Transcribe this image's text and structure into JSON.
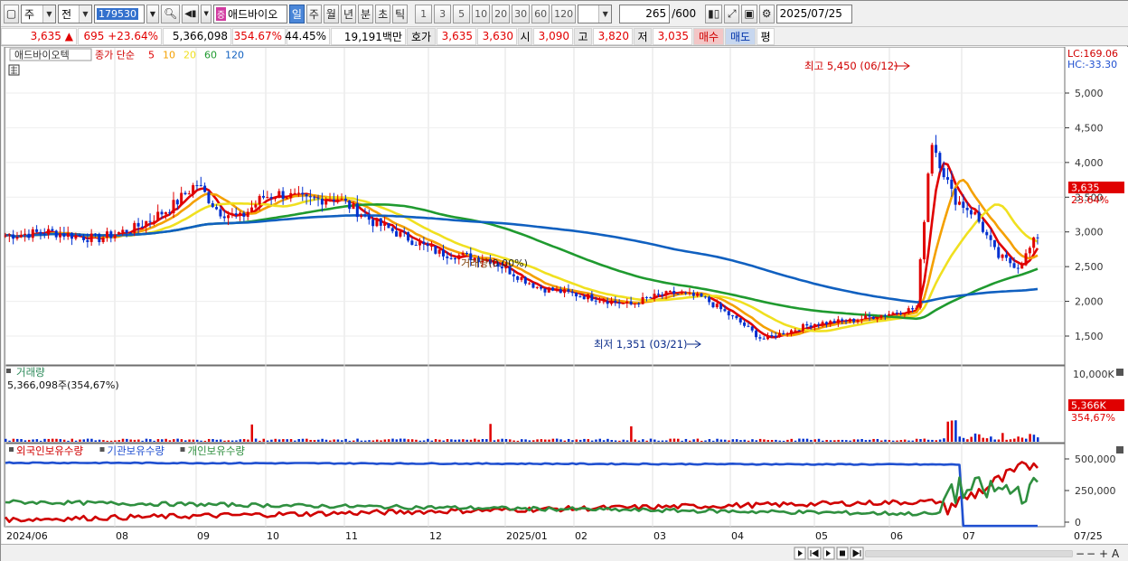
{
  "toolbar": {
    "period_select": "주",
    "type_select": "전",
    "stock_code": "179530",
    "stock_badge": "증",
    "stock_name": "애드바이오",
    "periods": [
      "일",
      "주",
      "월",
      "년",
      "분",
      "초",
      "틱"
    ],
    "period_active_index": 0,
    "multipliers": [
      "1",
      "3",
      "5",
      "10",
      "20",
      "30",
      "60",
      "120"
    ],
    "view_count": "265",
    "view_total": "/600",
    "date": "2025/07/25"
  },
  "quote": {
    "price": "3,635",
    "arrow": "▲",
    "change": "695",
    "change_pct": "+23.64%",
    "volume": "5,366,098",
    "volume_ratio": "354.67%",
    "turnover": "44.45%",
    "amount": "19,191백만",
    "ask_label": "호가",
    "ask": "3,635",
    "bid": "3,630",
    "open_label": "시",
    "open": "3,090",
    "high_label": "고",
    "high": "3,820",
    "low_label": "저",
    "low": "3,035",
    "sell_btn": "매수",
    "buy_btn": "매도",
    "eval_btn": "평"
  },
  "price_panel": {
    "stock_label": "애드바이오텍",
    "legend_title": "종가 단순",
    "ma_labels": [
      "5",
      "10",
      "20",
      "60",
      "120"
    ],
    "ma_colors": [
      "#e00000",
      "#f4a000",
      "#f0e020",
      "#1f9a2f",
      "#1060c0"
    ],
    "lc": "LC:169.06",
    "hc": "HC:-33.30",
    "high_annot": "최고 5,450 (06/12)",
    "low_annot": "최저 1,351 (03/21)",
    "mid_annot": "0.00%",
    "current_price_tag": "3,635",
    "current_change_tag": "23.64%",
    "y_ticks": [
      "5,000",
      "4,500",
      "4,000",
      "3,500",
      "3,000",
      "2,500",
      "2,000",
      "1,500"
    ]
  },
  "volume_panel": {
    "title": "거래량",
    "value_label": "5,366,098주(354,67%)",
    "y_ticks": [
      "10,000K"
    ],
    "current_tag": "5,366K",
    "current_pct": "354,67%"
  },
  "holding_panel": {
    "series": [
      "외국인보유수량",
      "기관보유수량",
      "개인보유수량"
    ],
    "series_colors": [
      "#d00000",
      "#2050d0",
      "#2f8f3f"
    ],
    "y_ticks": [
      "500,000",
      "250,000",
      "0"
    ]
  },
  "x_axis": {
    "ticks": [
      "2024/06",
      "08",
      "09",
      "10",
      "11",
      "12",
      "2025/01",
      "02",
      "03",
      "04",
      "05",
      "06",
      "07"
    ],
    "right_label": "07/25"
  },
  "bottom_icons": [
    "play-icon",
    "step-back-icon",
    "step-forward-icon",
    "stop-icon",
    "play-forward-icon",
    "zoom-out-icon",
    "zoom-in-icon",
    "font-icon"
  ]
}
